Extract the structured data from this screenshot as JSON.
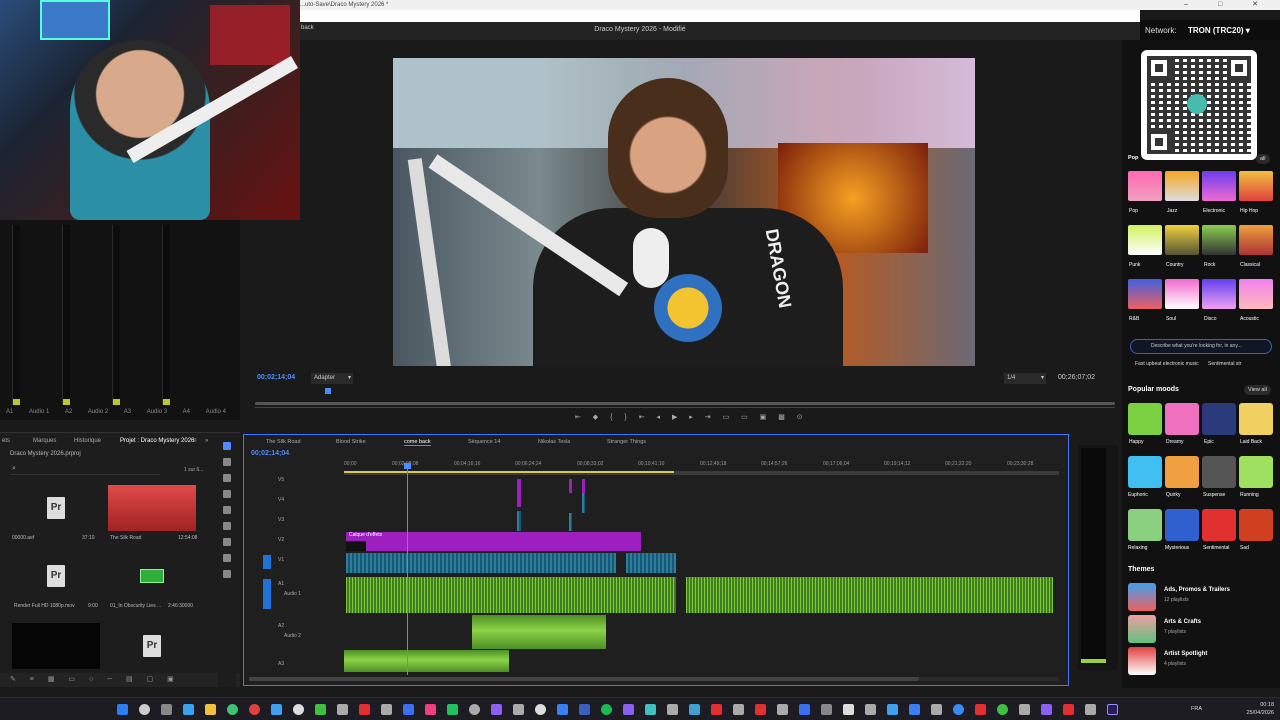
{
  "window": {
    "title_path": "...uto-Save\\Draco Mystery 2026 *",
    "doc_title": "Draco Mystery 2026 - Modifié",
    "menu_back": "back",
    "controls": "–  □  ✕"
  },
  "program_monitor": {
    "timecode": "00;02;14;04",
    "fit": "Adapter",
    "resolution": "1/4",
    "duration": "00;26;07;02",
    "shirt_text": "DRAGON",
    "buttons": "⇤ ◆ { } ⇤ ◂ ▶ ▸ ⇥ ▭ ▭ ▣ ▩ ⊙"
  },
  "audio_meter": {
    "labels": [
      "A1",
      "Audio 1",
      "A2",
      "Audio 2",
      "A3",
      "Audio 3",
      "A4",
      "Audio 4"
    ]
  },
  "project_panel": {
    "tabs": [
      "ets",
      "Marques",
      "Historique",
      "Projet : Draco Mystery 2026",
      "≡",
      "»"
    ],
    "project_file": "Draco Mystery 2026.prproj",
    "count": "1 sur 6...",
    "items": [
      {
        "name": "00000.aef",
        "duration": "37:10"
      },
      {
        "name": "The Silk Road",
        "duration": "12:54:08"
      },
      {
        "name": "Render Full HD 1080p.mov",
        "duration": "9:00"
      },
      {
        "name": "01_In Obscurity Lies ...",
        "duration": "2:46:30000"
      },
      {
        "name": "",
        "duration": ""
      },
      {
        "name": "",
        "duration": ""
      }
    ],
    "pr_label": "Pr"
  },
  "timeline": {
    "tabs": [
      "The Silk Road",
      "Blood Strike",
      "come back",
      "Séquence 14",
      "Nikolas Tesla",
      "Stranger Things"
    ],
    "active_tab": "come back",
    "timecode": "00;02;14;04",
    "ruler": [
      "00;00",
      "00;02;08;08",
      "00;04;16;16",
      "00;06;24;24",
      "00;08;33;02",
      "00;10;41;10",
      "00;12;49;18",
      "00;14;57;26",
      "00;17;06;04",
      "00;19;14;12",
      "00;21;22;20",
      "00;23;30;28"
    ],
    "tracks": [
      "V5",
      "V4",
      "V3",
      "V2",
      "V1",
      "A1",
      "A2",
      "A3"
    ],
    "a1_name": "Audio 1",
    "a2_name": "Audio 2",
    "effects_clip": "Calque d'effets"
  },
  "right_panel": {
    "network_label": "Network:",
    "network_value": "TRON (TRC20) ▾",
    "popular_label": "Pop",
    "popular_view_all": "all",
    "genres": [
      "Pop",
      "Jazz",
      "Electronic",
      "Hip Hop",
      "Punk",
      "Country",
      "Rock",
      "Classical",
      "R&B",
      "Soul",
      "Disco",
      "Acoustic"
    ],
    "search_placeholder": "Describe what you're looking for, in any...",
    "chip1": "Fast upbeat electronic music",
    "chip2": "Sentimental str",
    "moods_title": "Popular moods",
    "moods_view_all": "View all",
    "moods": [
      "Happy",
      "Dreamy",
      "Epic",
      "Laid Back",
      "Euphoric",
      "Quirky",
      "Suspense",
      "Running",
      "Relaxing",
      "Mysterious",
      "Sentimental",
      "Sad"
    ],
    "themes_title": "Themes",
    "themes": [
      {
        "name": "Ads, Promos & Trailers",
        "count": "12 playlists"
      },
      {
        "name": "Arts & Crafts",
        "count": "7 playlists"
      },
      {
        "name": "Artist Spotlight",
        "count": "4 playlists"
      }
    ]
  },
  "taskbar": {
    "lang": "FRA",
    "time": "00:18",
    "date": "25/04/2026"
  },
  "colors": {
    "accent": "#4e8cff",
    "effects_clip": "#9e1fc0",
    "audio_clip": "#7ecb3a",
    "video_clip": "#2a7fa0"
  }
}
